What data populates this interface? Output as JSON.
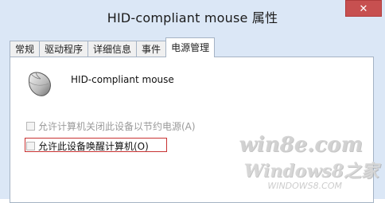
{
  "window": {
    "title": "HID-compliant mouse 属性",
    "close_glyph": "✕"
  },
  "tabs": [
    {
      "label": "常规",
      "active": false
    },
    {
      "label": "驱动程序",
      "active": false
    },
    {
      "label": "详细信息",
      "active": false
    },
    {
      "label": "事件",
      "active": false
    },
    {
      "label": "电源管理",
      "active": true
    }
  ],
  "panel": {
    "device_name": "HID-compliant mouse",
    "device_icon": "mouse-icon",
    "options": [
      {
        "label": "允许计算机关闭此设备以节约电源(A)",
        "checked": false,
        "enabled": false
      },
      {
        "label": "允许此设备唤醒计算机(O)",
        "checked": false,
        "enabled": true,
        "highlighted": true
      }
    ]
  },
  "watermark": {
    "line1": "win8e.com",
    "line2": "Windows8之家",
    "line3": "WINDOWS8.COM"
  },
  "colors": {
    "window_bg": "#dbe7f6",
    "close_button": "#c75050",
    "highlight_box": "#c83232"
  }
}
